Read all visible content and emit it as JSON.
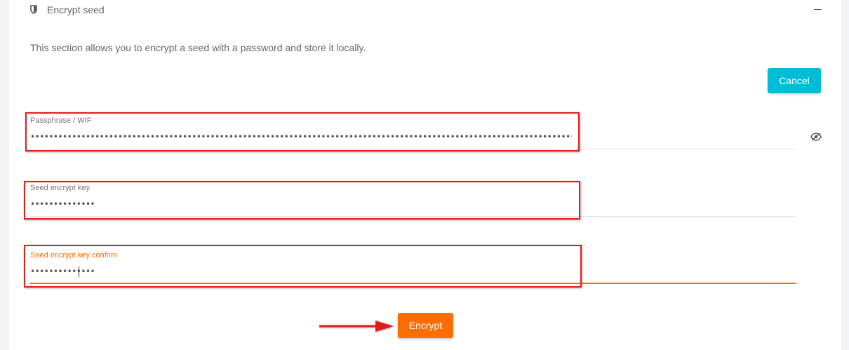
{
  "section": {
    "title": "Encrypt seed",
    "description": "This section allows you to encrypt a seed with a password and store it locally.",
    "header_icon": "shield-icon",
    "collapse_icon": "minus-icon"
  },
  "buttons": {
    "cancel_label": "Cancel",
    "encrypt_label": "Encrypt"
  },
  "fields": {
    "passphrase": {
      "label": "Passphrase / WIF",
      "value": "••••••••••••••••••••••••••••••••••••••••••••••••••••••••••••••••••••••••••••••••••••••••••••••••••••••••••••••••••••••••••••••••••••••••••••••••••••",
      "toggle_icon": "eye-slash-icon"
    },
    "seed_key": {
      "label": "Seed encrypt key",
      "value": "••••••••••••••"
    },
    "seed_key_confirm": {
      "label": "Seed encrypt key confirm",
      "value": "••••••••••••••"
    }
  },
  "colors": {
    "accent": "#ff6d00",
    "cancel": "#00bcd4",
    "highlight": "#e01e1e"
  }
}
